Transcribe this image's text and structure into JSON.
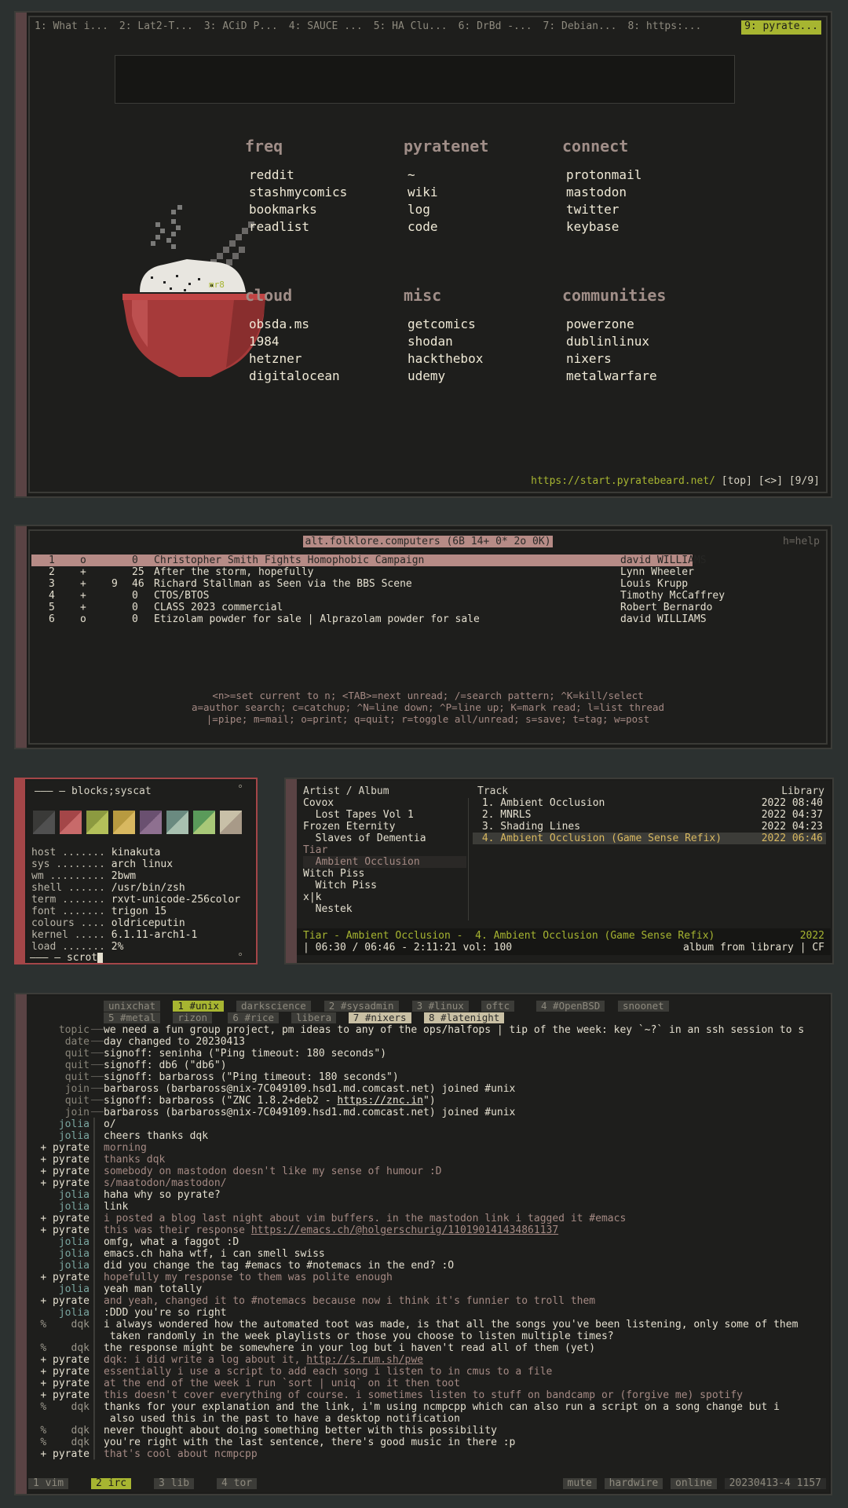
{
  "browser": {
    "tabs": [
      "1: What i...",
      "2: Lat2-T...",
      "3: ACiD P...",
      "4: SAUCE ...",
      "5: HA Clu...",
      "6: DrBd -...",
      "7: Debian...",
      "8: https:...",
      "9: pyrate..."
    ],
    "groups": [
      {
        "title": "freq",
        "links": [
          "reddit",
          "stashmycomics",
          "bookmarks",
          "readlist"
        ]
      },
      {
        "title": "pyratenet",
        "links": [
          "~",
          "wiki",
          "log",
          "code"
        ]
      },
      {
        "title": "connect",
        "links": [
          "protonmail",
          "mastodon",
          "twitter",
          "keybase"
        ]
      },
      {
        "title": "cloud",
        "links": [
          "obsda.ms",
          "1984",
          "hetzner",
          "digitalocean"
        ]
      },
      {
        "title": "misc",
        "links": [
          "getcomics",
          "shodan",
          "hackthebox",
          "udemy"
        ]
      },
      {
        "title": "communities",
        "links": [
          "powerzone",
          "dublinlinux",
          "nixers",
          "metalwarfare"
        ]
      }
    ],
    "bowl_tag": "mr8",
    "status_url": "https://start.pyratebeard.net/",
    "status_rest": " [top] [<>] [9/9]"
  },
  "newsreader": {
    "title": "alt.folklore.computers (6B 14+ 0* 2o 0K)",
    "help": "h=help",
    "threads": [
      {
        "n": "1",
        "flag": "o",
        "cnt": "",
        "sz": "0",
        "subject": "Christopher Smith Fights Homophobic Campaign",
        "author": "david WILLIAMS"
      },
      {
        "n": "2",
        "flag": "+",
        "cnt": "",
        "sz": "25",
        "subject": "After the storm, hopefully",
        "author": "Lynn Wheeler"
      },
      {
        "n": "3",
        "flag": "+",
        "cnt": "9",
        "sz": "46",
        "subject": "Richard Stallman as Seen via the BBS Scene",
        "author": "Louis Krupp"
      },
      {
        "n": "4",
        "flag": "+",
        "cnt": "",
        "sz": "0",
        "subject": "CTOS/BTOS",
        "author": "Timothy McCaffrey"
      },
      {
        "n": "5",
        "flag": "+",
        "cnt": "",
        "sz": "0",
        "subject": "CLASS 2023 commercial",
        "author": "Robert Bernardo"
      },
      {
        "n": "6",
        "flag": "o",
        "cnt": "",
        "sz": "0",
        "subject": "Etizolam powder for sale | Alprazolam powder for sale",
        "author": "david WILLIAMS"
      }
    ],
    "keys": [
      "<n>=set current to n; <TAB>=next unread; /=search pattern; ^K=kill/select",
      "a=author search; c=catchup; ^N=line down; ^P=line up; K=mark read; l=list thread",
      "|=pipe; m=mail; o=print; q=quit; r=toggle all/unread; s=save; t=tag; w=post"
    ]
  },
  "sysinfo": {
    "header": "——— – blocks;syscat",
    "corner": "°",
    "swatches": [
      [
        "#3a3a38",
        "#505050"
      ],
      [
        "#a44648",
        "#c86a6a"
      ],
      [
        "#8c9a40",
        "#b4c05a"
      ],
      [
        "#b89a40",
        "#d8b860"
      ],
      [
        "#6a5070",
        "#8e7090"
      ],
      [
        "#6a8a80",
        "#a8c0b0"
      ],
      [
        "#5a9a5a",
        "#a8c878"
      ],
      [
        "#c8c0a8",
        "#a89a88"
      ]
    ],
    "rows": [
      {
        "k": "host .......",
        "v": "kinakuta"
      },
      {
        "k": "sys ........",
        "v": "arch linux"
      },
      {
        "k": "wm .........",
        "v": "2bwm"
      },
      {
        "k": "shell ......",
        "v": "/usr/bin/zsh"
      },
      {
        "k": "term .......",
        "v": "rxvt-unicode-256color"
      },
      {
        "k": "font .......",
        "v": "trigon 15"
      },
      {
        "k": "colours ....",
        "v": "oldriceputin"
      },
      {
        "k": "kernel .....",
        "v": "6.1.11-arch1-1"
      },
      {
        "k": "load .......",
        "v": "2%"
      }
    ],
    "footer": "——— – scrot",
    "footer_corner": "°"
  },
  "player": {
    "col_artist": "Artist / Album",
    "col_track": "Track",
    "col_lib": "Library",
    "tree": [
      {
        "t": "Covox",
        "c": "#e4dfcf"
      },
      {
        "t": "  Lost Tapes Vol 1",
        "c": "#e4dfcf"
      },
      {
        "t": "Frozen Eternity",
        "c": "#e4dfcf"
      },
      {
        "t": "  Slaves of Dementia",
        "c": "#e4dfcf"
      },
      {
        "t": "Tiar",
        "c": "#a58a84"
      },
      {
        "t": "  Ambient Occlusion",
        "c": "#a58a84"
      },
      {
        "t": "Witch Piss",
        "c": "#e4dfcf"
      },
      {
        "t": "  Witch Piss",
        "c": "#e4dfcf"
      },
      {
        "t": "x|k",
        "c": "#e4dfcf"
      },
      {
        "t": "  Nestek",
        "c": "#e4dfcf"
      }
    ],
    "tracks": [
      {
        "t": " 1. Ambient Occlusion",
        "m": "2022 08:40"
      },
      {
        "t": " 2. MNRLS",
        "m": "2022 04:37"
      },
      {
        "t": " 3. Shading Lines",
        "m": "2022 04:23"
      },
      {
        "t": " 4. Ambient Occlusion (Game Sense Refix)",
        "m": "2022 06:46"
      }
    ],
    "now_left": "Tiar - Ambient Occlusion -  4. Ambient Occlusion (Game Sense Refix)",
    "now_right": "2022",
    "progress_left": "| 06:30 / 06:46 - 2:11:21 vol: 100",
    "progress_right": "album from library | CF"
  },
  "irc": {
    "channels_row1": [
      {
        "n": "unixchat",
        "s": ""
      },
      {
        "n": "1 #unix",
        "s": "act"
      },
      {
        "n": "darkscience",
        "s": ""
      },
      {
        "n": "2 #sysadmin",
        "s": ""
      },
      {
        "n": "3 #linux",
        "s": ""
      },
      {
        "n": "oftc",
        "s": ""
      },
      {
        "n": "4 #OpenBSD",
        "s": ""
      },
      {
        "n": "snoonet",
        "s": ""
      }
    ],
    "channels_row2": [
      {
        "n": "5 #metal",
        "s": ""
      },
      {
        "n": "rizon",
        "s": ""
      },
      {
        "n": "6 #rice",
        "s": ""
      },
      {
        "n": "libera",
        "s": ""
      },
      {
        "n": "7 #nixers",
        "s": "hl"
      },
      {
        "n": "8 #latenight",
        "s": "hl"
      }
    ],
    "lines": [
      {
        "nick": "topic",
        "msg": "we need a fun group project, pm ideas to any of the ops/halfops | tip of the week: key `~?` in an ssh session to s",
        "nc": "c-sys",
        "mc": "c-t",
        "sep": "──"
      },
      {
        "nick": "date",
        "msg": "day changed to 20230413",
        "nc": "c-sys",
        "mc": "c-t",
        "sep": "──"
      },
      {
        "nick": "quit",
        "msg": "signoff: seninha (\"Ping timeout: 180 seconds\")",
        "nc": "c-sys",
        "mc": "c-t",
        "sep": "──"
      },
      {
        "nick": "quit",
        "msg": "signoff: db6 (\"db6\")",
        "nc": "c-sys",
        "mc": "c-t",
        "sep": "──"
      },
      {
        "nick": "quit",
        "msg": "signoff: barbaross (\"Ping timeout: 180 seconds\")",
        "nc": "c-sys",
        "mc": "c-t",
        "sep": "──"
      },
      {
        "nick": "join",
        "msg": "barbaross (barbaross@nix-7C049109.hsd1.md.comcast.net) joined #unix",
        "nc": "c-sys",
        "mc": "c-t",
        "sep": "──"
      },
      {
        "nick": "quit",
        "msg": "signoff: barbaross (\"ZNC 1.8.2+deb2 - https://znc.in\")",
        "nc": "c-sys",
        "mc": "c-t",
        "sep": "──"
      },
      {
        "nick": "join",
        "msg": "barbaross (barbaross@nix-7C049109.hsd1.md.comcast.net) joined #unix",
        "nc": "c-sys",
        "mc": "c-t",
        "sep": "──"
      },
      {
        "nick": "jolia",
        "msg": "o/",
        "nc": "c-j",
        "mc": "c-t",
        "sep": "│"
      },
      {
        "nick": "jolia",
        "msg": "cheers thanks dqk",
        "nc": "c-j",
        "mc": "c-t",
        "sep": "│"
      },
      {
        "nick": "+ pyrate",
        "msg": "morning",
        "nc": "c-t",
        "mc": "c-p",
        "sep": "│"
      },
      {
        "nick": "+ pyrate",
        "msg": "thanks dqk",
        "nc": "c-t",
        "mc": "c-p",
        "sep": "│"
      },
      {
        "nick": "+ pyrate",
        "msg": "somebody on mastodon doesn't like my sense of humour :D",
        "nc": "c-t",
        "mc": "c-p",
        "sep": "│"
      },
      {
        "nick": "+ pyrate",
        "msg": "s/maatodon/mastodon/",
        "nc": "c-t",
        "mc": "c-p",
        "sep": "│"
      },
      {
        "nick": "jolia",
        "msg": "haha why so pyrate?",
        "nc": "c-j",
        "mc": "c-t",
        "sep": "│"
      },
      {
        "nick": "jolia",
        "msg": "link",
        "nc": "c-j",
        "mc": "c-t",
        "sep": "│"
      },
      {
        "nick": "+ pyrate",
        "msg": "i posted a blog last night about vim buffers. in the mastodon link i tagged it #emacs",
        "nc": "c-t",
        "mc": "c-p",
        "sep": "│"
      },
      {
        "nick": "+ pyrate",
        "msg": "this was their response https://emacs.ch/@holgerschurig/110190141434861137",
        "nc": "c-t",
        "mc": "c-p",
        "sep": "│"
      },
      {
        "nick": "jolia",
        "msg": "omfg, what a faggot :D",
        "nc": "c-j",
        "mc": "c-t",
        "sep": "│"
      },
      {
        "nick": "jolia",
        "msg": "emacs.ch haha wtf, i can smell swiss",
        "nc": "c-j",
        "mc": "c-t",
        "sep": "│"
      },
      {
        "nick": "jolia",
        "msg": "did you change the tag #emacs to #notemacs in the end? :O",
        "nc": "c-j",
        "mc": "c-t",
        "sep": "│"
      },
      {
        "nick": "+ pyrate",
        "msg": "hopefully my response to them was polite enough",
        "nc": "c-t",
        "mc": "c-p",
        "sep": "│"
      },
      {
        "nick": "jolia",
        "msg": "yeah man totally",
        "nc": "c-j",
        "mc": "c-t",
        "sep": "│"
      },
      {
        "nick": "+ pyrate",
        "msg": "and yeah, changed it to #notemacs because now i think it's funnier to troll them",
        "nc": "c-t",
        "mc": "c-p",
        "sep": "│"
      },
      {
        "nick": "jolia",
        "msg": ":DDD you're so right",
        "nc": "c-j",
        "mc": "c-t",
        "sep": "│"
      },
      {
        "nick": "%    dqk",
        "msg": "i always wondered how the automated toot was made, is that all the songs you've been listening, only some of them",
        "nc": "c-d",
        "mc": "c-t",
        "sep": "│"
      },
      {
        "nick": "",
        "msg": " taken randomly in the week playlists or those you choose to listen multiple times?",
        "nc": "c-d",
        "mc": "c-t",
        "sep": "│"
      },
      {
        "nick": "%    dqk",
        "msg": "the response might be somewhere in your log but i haven't read all of them (yet)",
        "nc": "c-d",
        "mc": "c-t",
        "sep": "│"
      },
      {
        "nick": "+ pyrate",
        "msg": "dqk: i did write a log about it, http://s.rum.sh/pwe",
        "nc": "c-t",
        "mc": "c-p",
        "sep": "│"
      },
      {
        "nick": "+ pyrate",
        "msg": "essentially i use a script to add each song i listen to in cmus to a file",
        "nc": "c-t",
        "mc": "c-p",
        "sep": "│"
      },
      {
        "nick": "+ pyrate",
        "msg": "at the end of the week i run `sort | uniq` on it then toot",
        "nc": "c-t",
        "mc": "c-p",
        "sep": "│"
      },
      {
        "nick": "+ pyrate",
        "msg": "this doesn't cover everything of course. i sometimes listen to stuff on bandcamp or (forgive me) spotify",
        "nc": "c-t",
        "mc": "c-p",
        "sep": "│"
      },
      {
        "nick": "%    dqk",
        "msg": "thanks for your explanation and the link, i'm using ncmpcpp which can also run a script on a song change but i",
        "nc": "c-d",
        "mc": "c-t",
        "sep": "│"
      },
      {
        "nick": "",
        "msg": " also used this in the past to have a desktop notification",
        "nc": "c-d",
        "mc": "c-t",
        "sep": "│"
      },
      {
        "nick": "%    dqk",
        "msg": "never thought about doing something better with this possibility",
        "nc": "c-d",
        "mc": "c-t",
        "sep": "│"
      },
      {
        "nick": "%    dqk",
        "msg": "you're right with the last sentence, there's good music in there :p",
        "nc": "c-d",
        "mc": "c-t",
        "sep": "│"
      },
      {
        "nick": "+ pyrate",
        "msg": "that's cool about ncmpcpp",
        "nc": "c-t",
        "mc": "c-p",
        "sep": "│"
      }
    ],
    "bottom_tabs": [
      {
        "n": "1 vim",
        "s": ""
      },
      {
        "n": "2 irc",
        "s": "act"
      },
      {
        "n": "3 lib",
        "s": ""
      },
      {
        "n": "4 tor",
        "s": ""
      }
    ],
    "bottom_right": [
      "mute",
      "hardwire",
      "online",
      "20230413-4 1157"
    ]
  }
}
